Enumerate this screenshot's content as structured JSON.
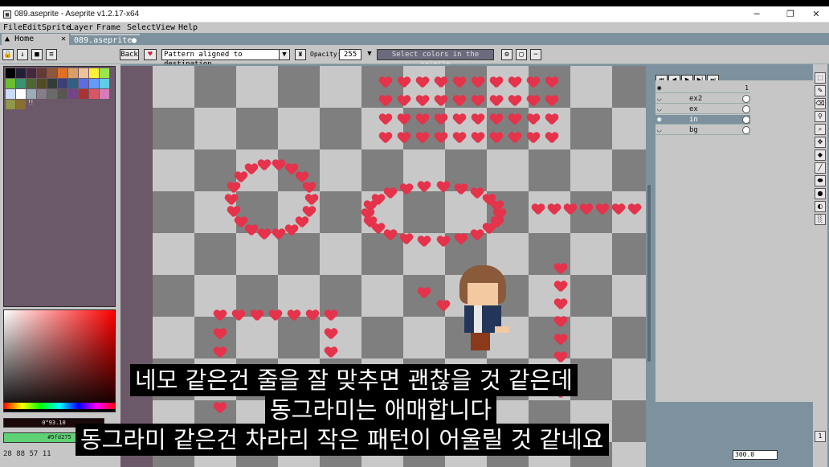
{
  "window": {
    "title": "089.aseprite - Aseprite v1.2.17-x64",
    "app_icon": "aseprite-icon",
    "minimize": "─",
    "maximize": "❐",
    "close": "✕"
  },
  "menu": [
    "File",
    "Edit",
    "Sprite",
    "Layer",
    "Frame",
    "Select",
    "View",
    "Help"
  ],
  "tabs": {
    "home": {
      "label": "Home",
      "close": "✕"
    },
    "file": {
      "label": "089.aseprite",
      "dot": "●"
    }
  },
  "toolbar": {
    "back_label": "Back",
    "ink_mode": "Pattern aligned to destination",
    "opacity_label": "Opacity:",
    "opacity_value": "255",
    "selection_hint": "Select colors in the palette"
  },
  "palette": {
    "colors": [
      "#000000",
      "#222034",
      "#45283c",
      "#663931",
      "#8f563b",
      "#df7126",
      "#d9a066",
      "#eec39a",
      "#fbf236",
      "#99e550",
      "#6abe30",
      "#37946e",
      "#4b692f",
      "#524b24",
      "#323c39",
      "#3f3f74",
      "#306082",
      "#5b6ee1",
      "#639bff",
      "#5fcde4",
      "#cbdbfc",
      "#ffffff",
      "#9badb7",
      "#847e87",
      "#696a6a",
      "#595652",
      "#76428a",
      "#ac3232",
      "#d95763",
      "#d77bba",
      "#8f974a",
      "#8a6f30"
    ],
    "extra_label": "!!"
  },
  "colors": {
    "foreground": "#1b0808",
    "foreground_label": "0°93.10",
    "background": "#5fd275",
    "background_label": "#5fd275"
  },
  "status": {
    "coords": "28  88  57  11"
  },
  "layers": [
    {
      "name": "",
      "selected": false,
      "cel": "1"
    },
    {
      "name": "ex2",
      "selected": false
    },
    {
      "name": "ex",
      "selected": false
    },
    {
      "name": "in",
      "selected": true
    },
    {
      "name": "bg",
      "selected": false
    }
  ],
  "zoom": {
    "value": "300.0",
    "frame": "1"
  },
  "subtitles": {
    "line1": "네모 같은건 줄을 잘 맞추면 괜찮을 것 같은데",
    "line2": "동그라미는 애매합니다",
    "line3": "동그라미 같은건 차라리 작은 패턴이 어울릴 것 같네요"
  }
}
